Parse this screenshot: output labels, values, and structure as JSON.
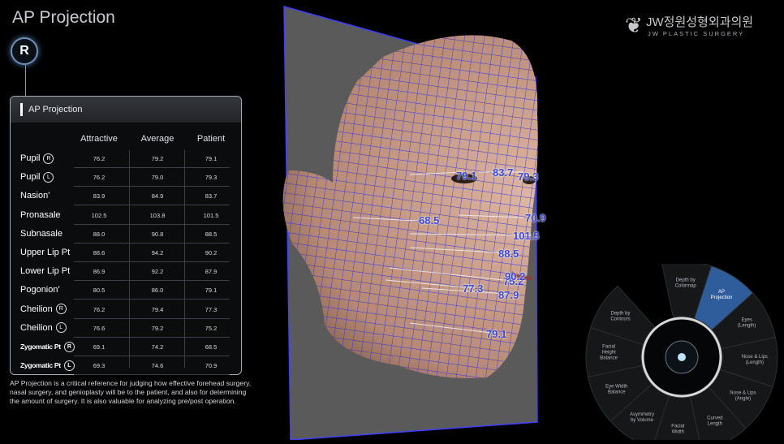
{
  "title": "AP Projection",
  "side_badge": "R",
  "logo": {
    "kr": "JW정원성형외과의원",
    "en": "JW PLASTIC SURGERY"
  },
  "panel": {
    "header": "AP Projection",
    "columns": [
      "Attractive",
      "Average",
      "Patient"
    ],
    "rows": [
      {
        "label": "Pupil",
        "side": "R",
        "values": [
          "76.2",
          "79.2",
          "79.1"
        ]
      },
      {
        "label": "Pupil",
        "side": "L",
        "values": [
          "76.2",
          "79.0",
          "79.3"
        ]
      },
      {
        "label": "Nasion'",
        "side": "",
        "values": [
          "83.9",
          "84.9",
          "83.7"
        ]
      },
      {
        "label": "Pronasale",
        "side": "",
        "values": [
          "102.5",
          "103.8",
          "101.5"
        ]
      },
      {
        "label": "Subnasale",
        "side": "",
        "values": [
          "88.0",
          "90.8",
          "88.5"
        ]
      },
      {
        "label": "Upper Lip Pt",
        "side": "",
        "values": [
          "88.6",
          "94.2",
          "90.2"
        ]
      },
      {
        "label": "Lower Lip Pt",
        "side": "",
        "values": [
          "86.9",
          "92.2",
          "87.9"
        ]
      },
      {
        "label": "Pogonion'",
        "side": "",
        "values": [
          "80.5",
          "86.0",
          "79.1"
        ]
      },
      {
        "label": "Cheilion",
        "side": "R",
        "values": [
          "76.2",
          "79.4",
          "77.3"
        ]
      },
      {
        "label": "Cheilion",
        "side": "L",
        "values": [
          "76.6",
          "79.2",
          "75.2"
        ]
      },
      {
        "label": "Zygomatic Pt",
        "side": "R",
        "values": [
          "69.1",
          "74.2",
          "68.5"
        ]
      },
      {
        "label": "Zygomatic Pt",
        "side": "L",
        "values": [
          "69.3",
          "74.6",
          "70.9"
        ]
      }
    ]
  },
  "description": "AP Projection is a critical reference for judging how effective forehead surgery, nasal surgery, and genioplasty will be to the patient, and also for determining the amount of surgery. It is also valuable for analyzing pre/post operation.",
  "face_labels": [
    "79.1",
    "83.7",
    "79.3",
    "68.5",
    "70.9",
    "101.5",
    "88.5",
    "75.2",
    "77.3",
    "87.9",
    "90.2",
    "79.1"
  ],
  "menu": {
    "items": [
      "Depth by Colormap",
      "AP Projection",
      "Eyes (Length)",
      "Nose & Lips (Length)",
      "Nose & Lips (Angle)",
      "Curved Length",
      "Facial Width",
      "Asymmetry by Volume",
      "Eye Width Balance",
      "Facial Height Balance",
      "Depth by Contours"
    ],
    "active": "AP Projection",
    "active_color": "#2f5c9a"
  }
}
